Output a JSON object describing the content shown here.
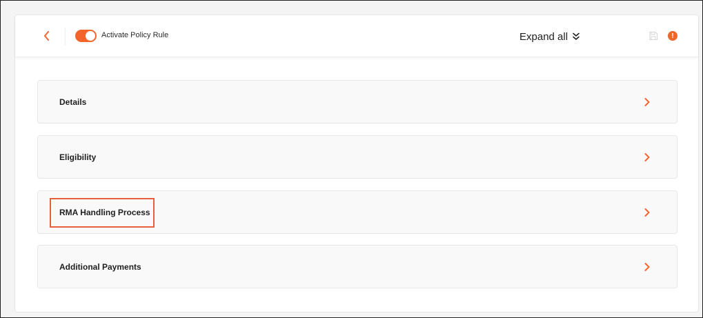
{
  "toolbar": {
    "activate_label": "Activate Policy Rule",
    "activate_on": true,
    "expand_all_label": "Expand all"
  },
  "sections": [
    {
      "label": "Details"
    },
    {
      "label": "Eligibility"
    },
    {
      "label": "RMA Handling Process",
      "highlighted": true
    },
    {
      "label": "Additional Payments"
    }
  ],
  "colors": {
    "accent": "#f2662b",
    "highlight_border": "#e5603a"
  },
  "icons": {
    "back": "chevron-left-icon",
    "expand": "double-chevron-down-icon",
    "save": "save-icon",
    "info": "info-icon",
    "section": "chevron-right-icon"
  }
}
